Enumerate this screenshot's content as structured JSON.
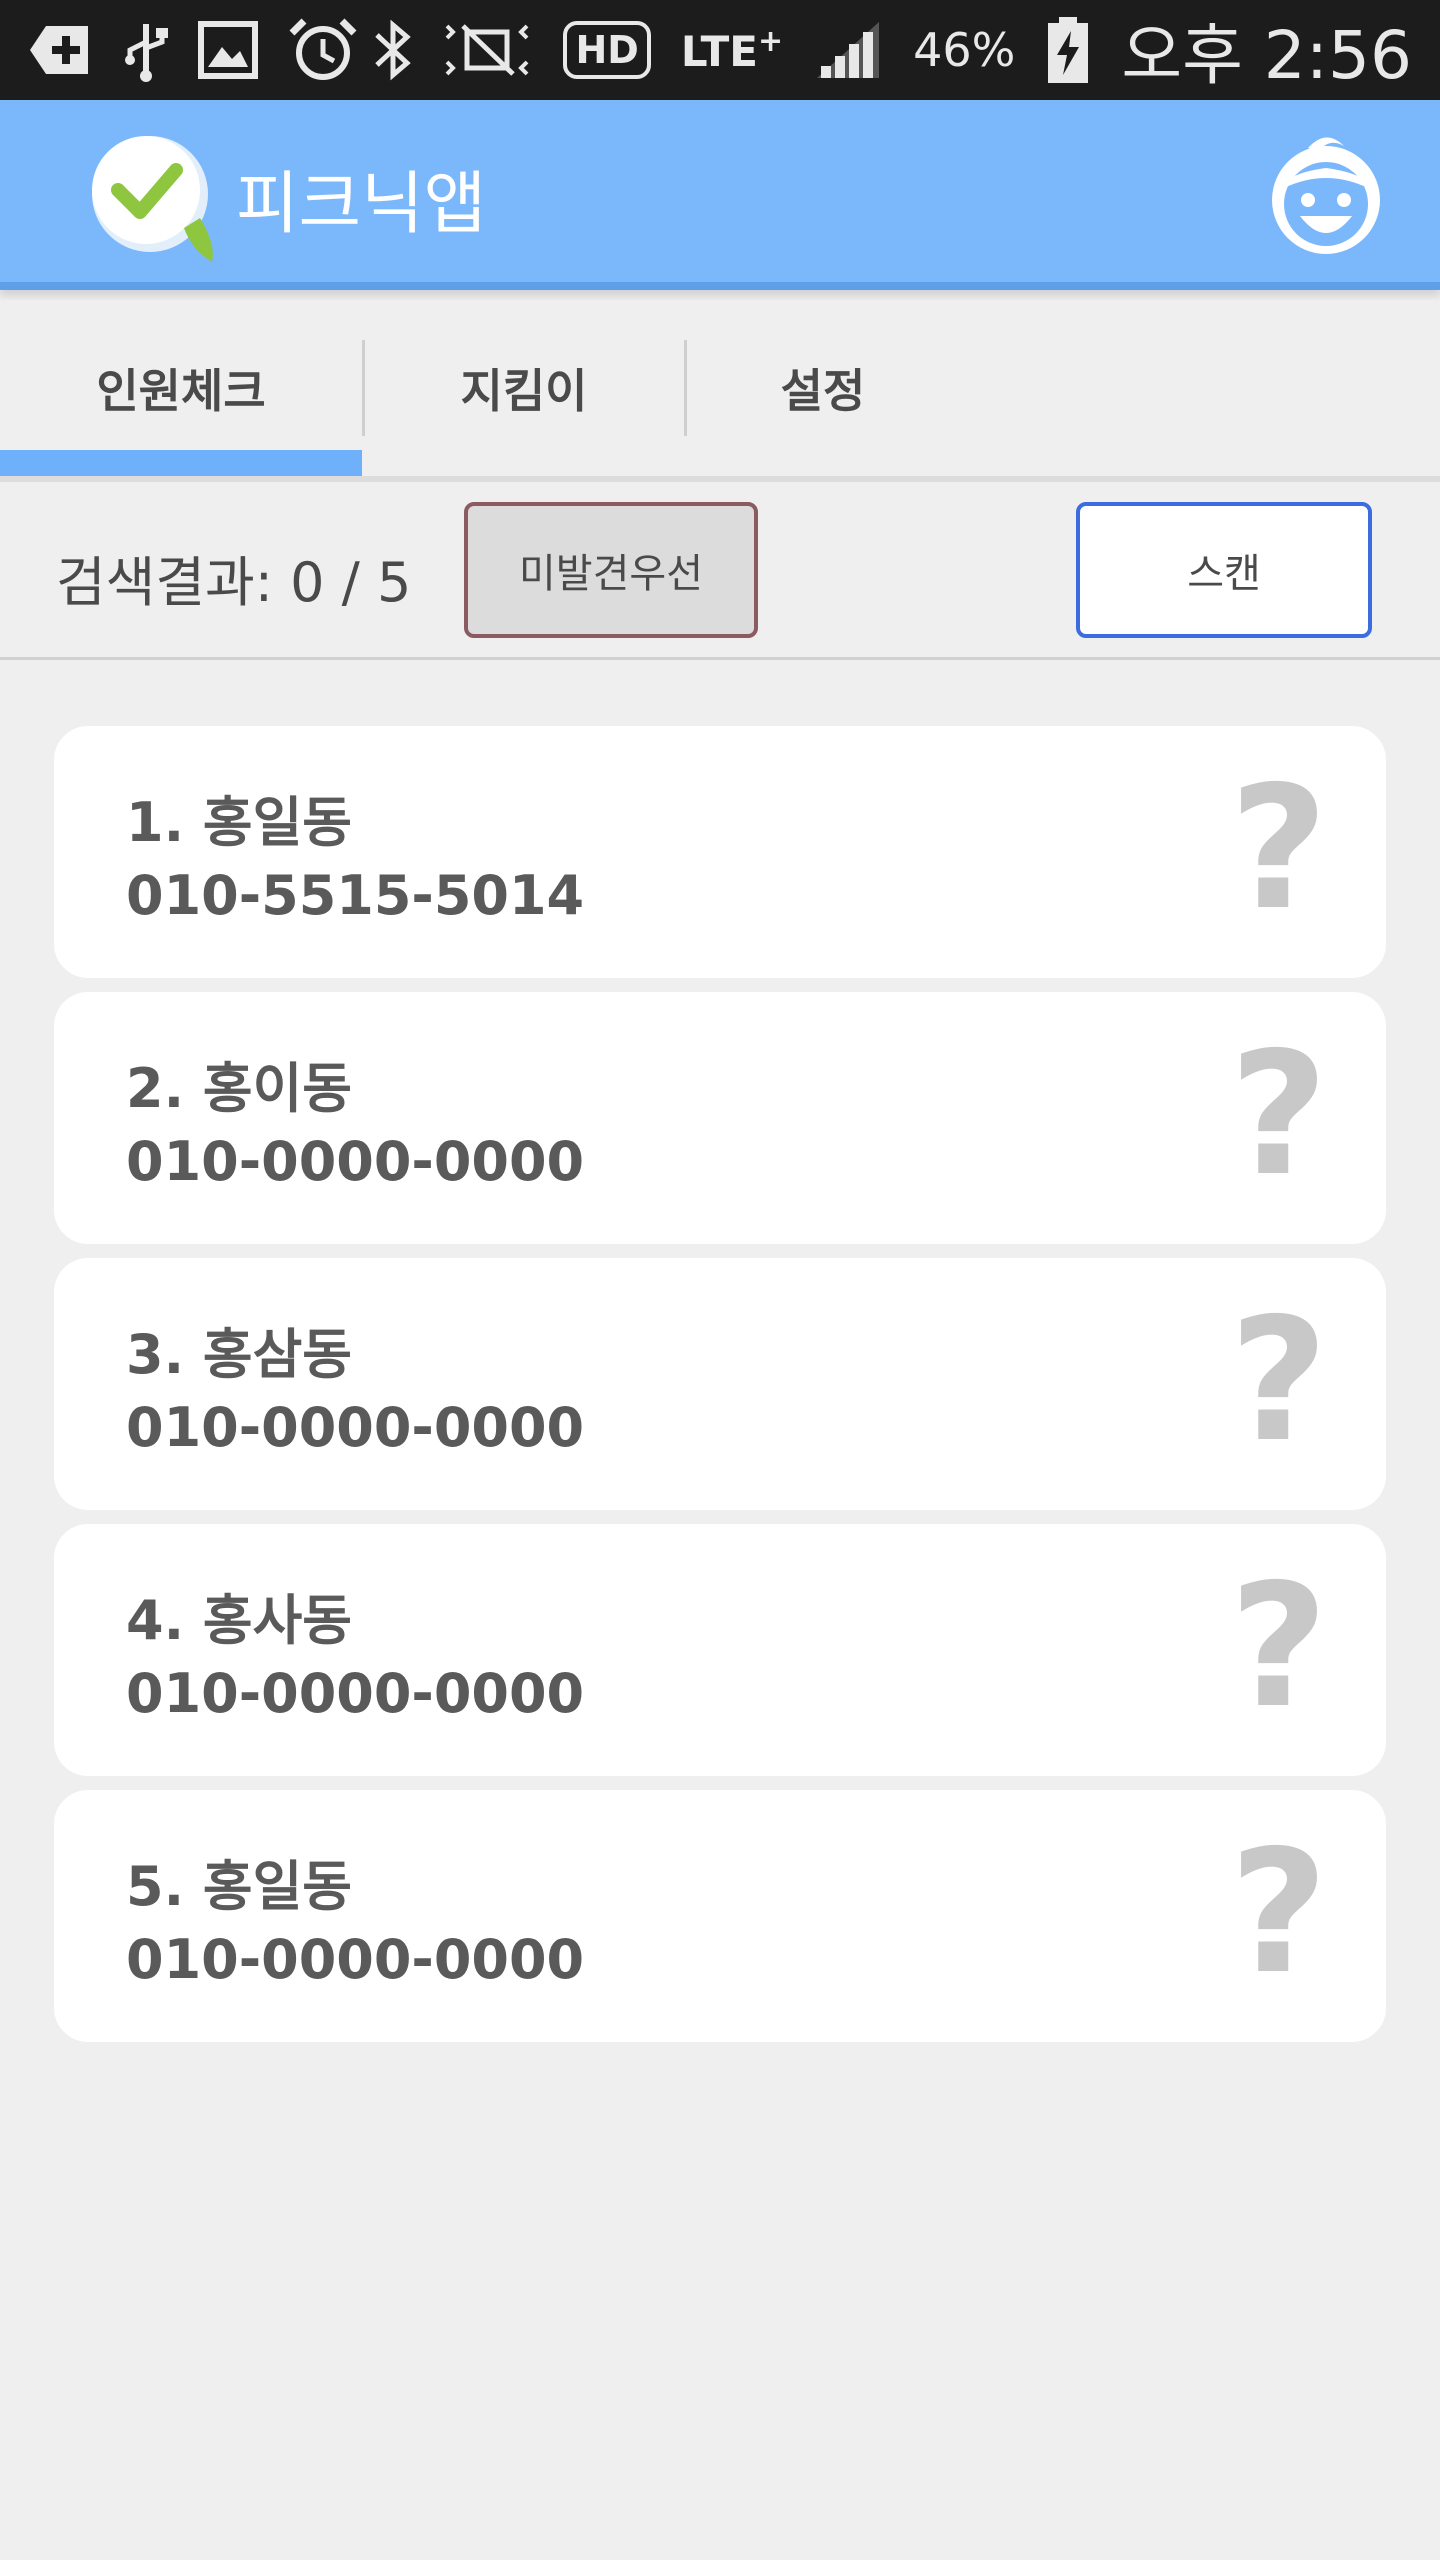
{
  "status_bar": {
    "battery": "46%",
    "time": "오후 2:56",
    "hd": "HD",
    "network": "LTE",
    "network_sup": "+",
    "icons": [
      "add-icon",
      "usb-icon",
      "image-icon",
      "alarm-icon",
      "bluetooth-icon",
      "mute-icon",
      "hd-icon",
      "lte-icon",
      "signal-icon",
      "battery-icon"
    ]
  },
  "app_bar": {
    "title": "피크닉앱",
    "logo": "checkmark-logo-icon",
    "profile_icon": "child-face-icon",
    "accent": "#7bb8fb"
  },
  "tabs": [
    {
      "label": "인원체크",
      "active": true
    },
    {
      "label": "지킴이",
      "active": false
    },
    {
      "label": "설정",
      "active": false
    }
  ],
  "search": {
    "result_label": "검색결과:  0 / 5",
    "unfound_button": "미발견우선",
    "scan_button": "스캔"
  },
  "people": [
    {
      "name": "1. 홍일동",
      "phone": "010-5515-5014",
      "status": "?"
    },
    {
      "name": "2. 홍이동",
      "phone": "010-0000-0000",
      "status": "?"
    },
    {
      "name": "3. 홍삼동",
      "phone": "010-0000-0000",
      "status": "?"
    },
    {
      "name": "4. 홍사동",
      "phone": "010-0000-0000",
      "status": "?"
    },
    {
      "name": "5. 홍일동",
      "phone": "010-0000-0000",
      "status": "?"
    }
  ]
}
